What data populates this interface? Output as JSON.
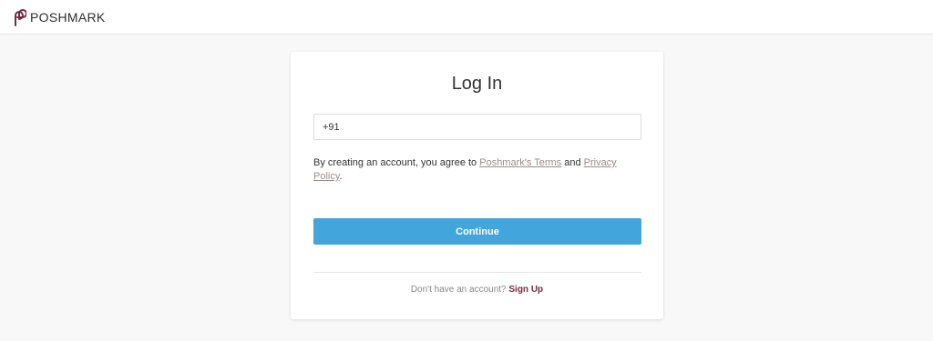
{
  "header": {
    "brand": "POSHMARK",
    "logo_icon": "poshmark-logo-icon",
    "brand_color": "#7a2a3a"
  },
  "login": {
    "title": "Log In",
    "phone_value": "+91",
    "terms_prefix": "By creating an account, you agree to ",
    "terms_link": "Poshmark's Terms",
    "terms_and": " and ",
    "privacy_link": "Privacy Policy",
    "terms_suffix": ".",
    "continue_label": "Continue",
    "continue_color": "#42a5dc",
    "no_account_text": "Don't have an account? ",
    "signup_label": "Sign Up"
  }
}
